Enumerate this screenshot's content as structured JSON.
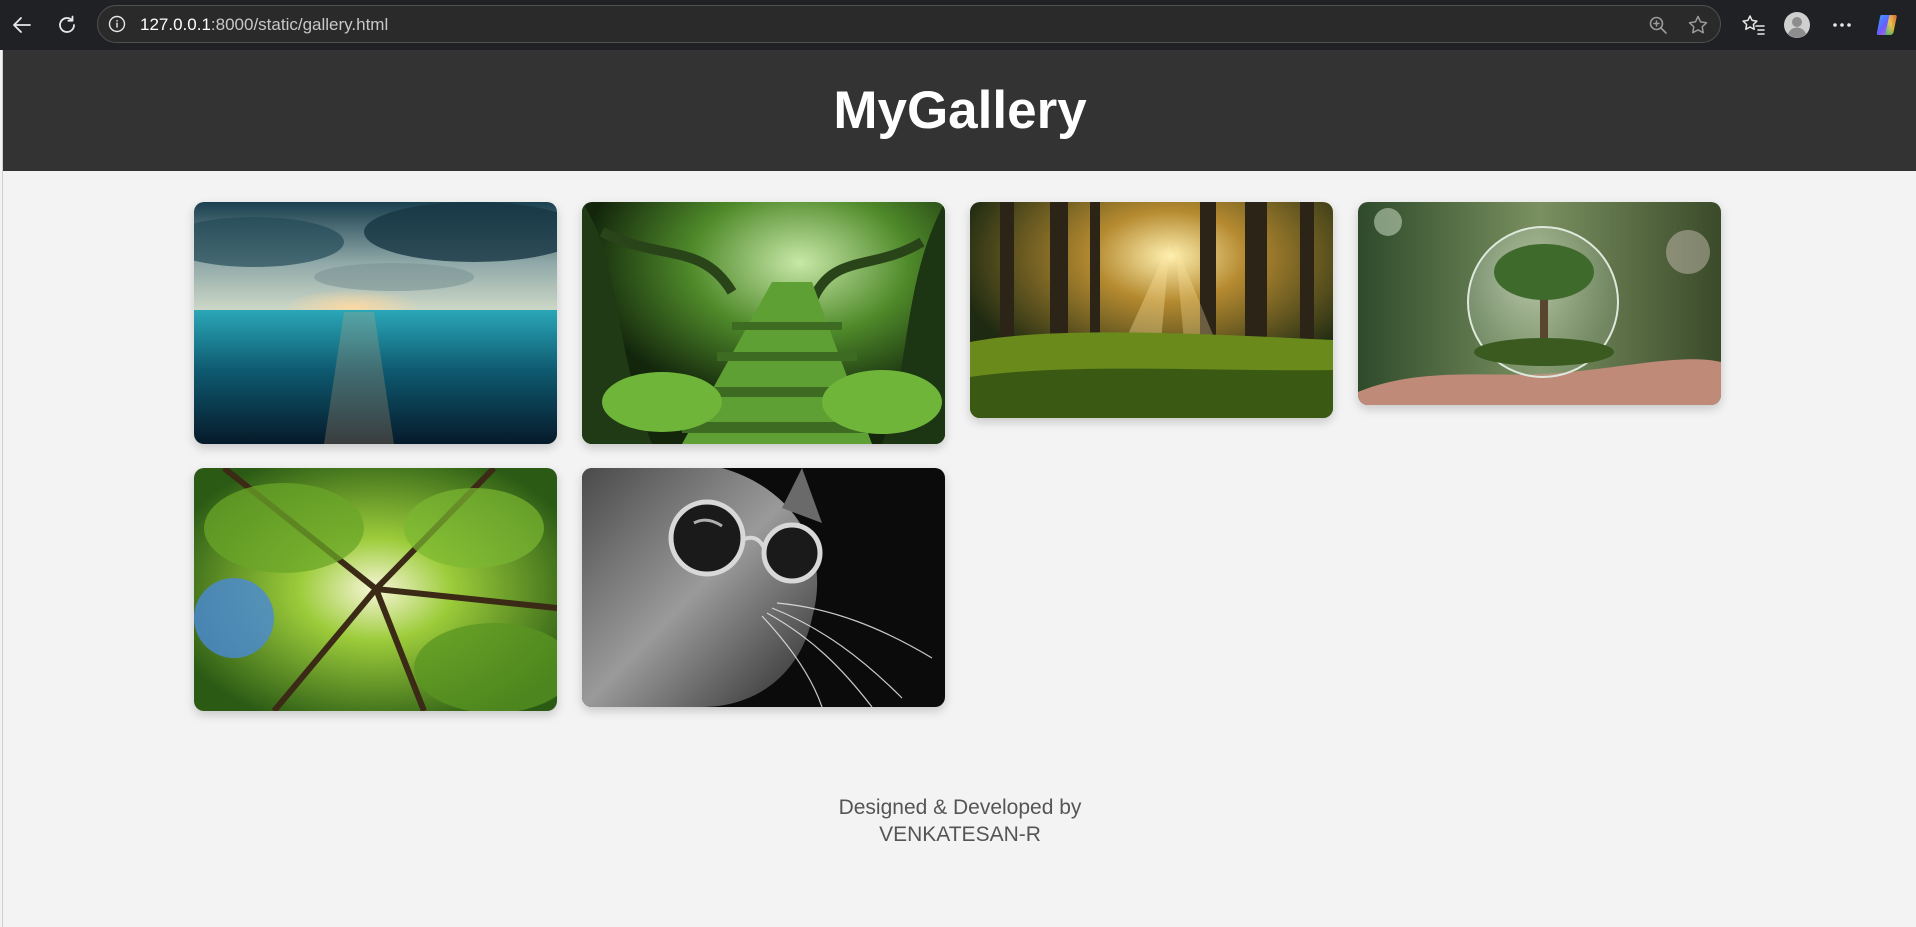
{
  "browser": {
    "url_host": "127.0.0.1",
    "url_rest": ":8000/static/gallery.html",
    "icons": [
      "back-icon",
      "reload-icon",
      "site-info-icon",
      "zoom-icon",
      "favorite-star-icon",
      "favorites-list-icon",
      "profile-avatar-icon",
      "more-options-icon",
      "copilot-icon"
    ]
  },
  "site": {
    "title": "MyGallery"
  },
  "gallery": {
    "images": [
      {
        "subject": "ocean under stormy sky at sunset"
      },
      {
        "subject": "mossy stone stairway in green forest"
      },
      {
        "subject": "sunbeams through forest trees"
      },
      {
        "subject": "tree inside glass sphere held in hands"
      },
      {
        "subject": "looking up at green tree canopy"
      },
      {
        "subject": "black and white cat wearing sunglasses"
      }
    ]
  },
  "footer": {
    "line1": "Designed & Developed by",
    "line2": "VENKATESAN-R"
  }
}
